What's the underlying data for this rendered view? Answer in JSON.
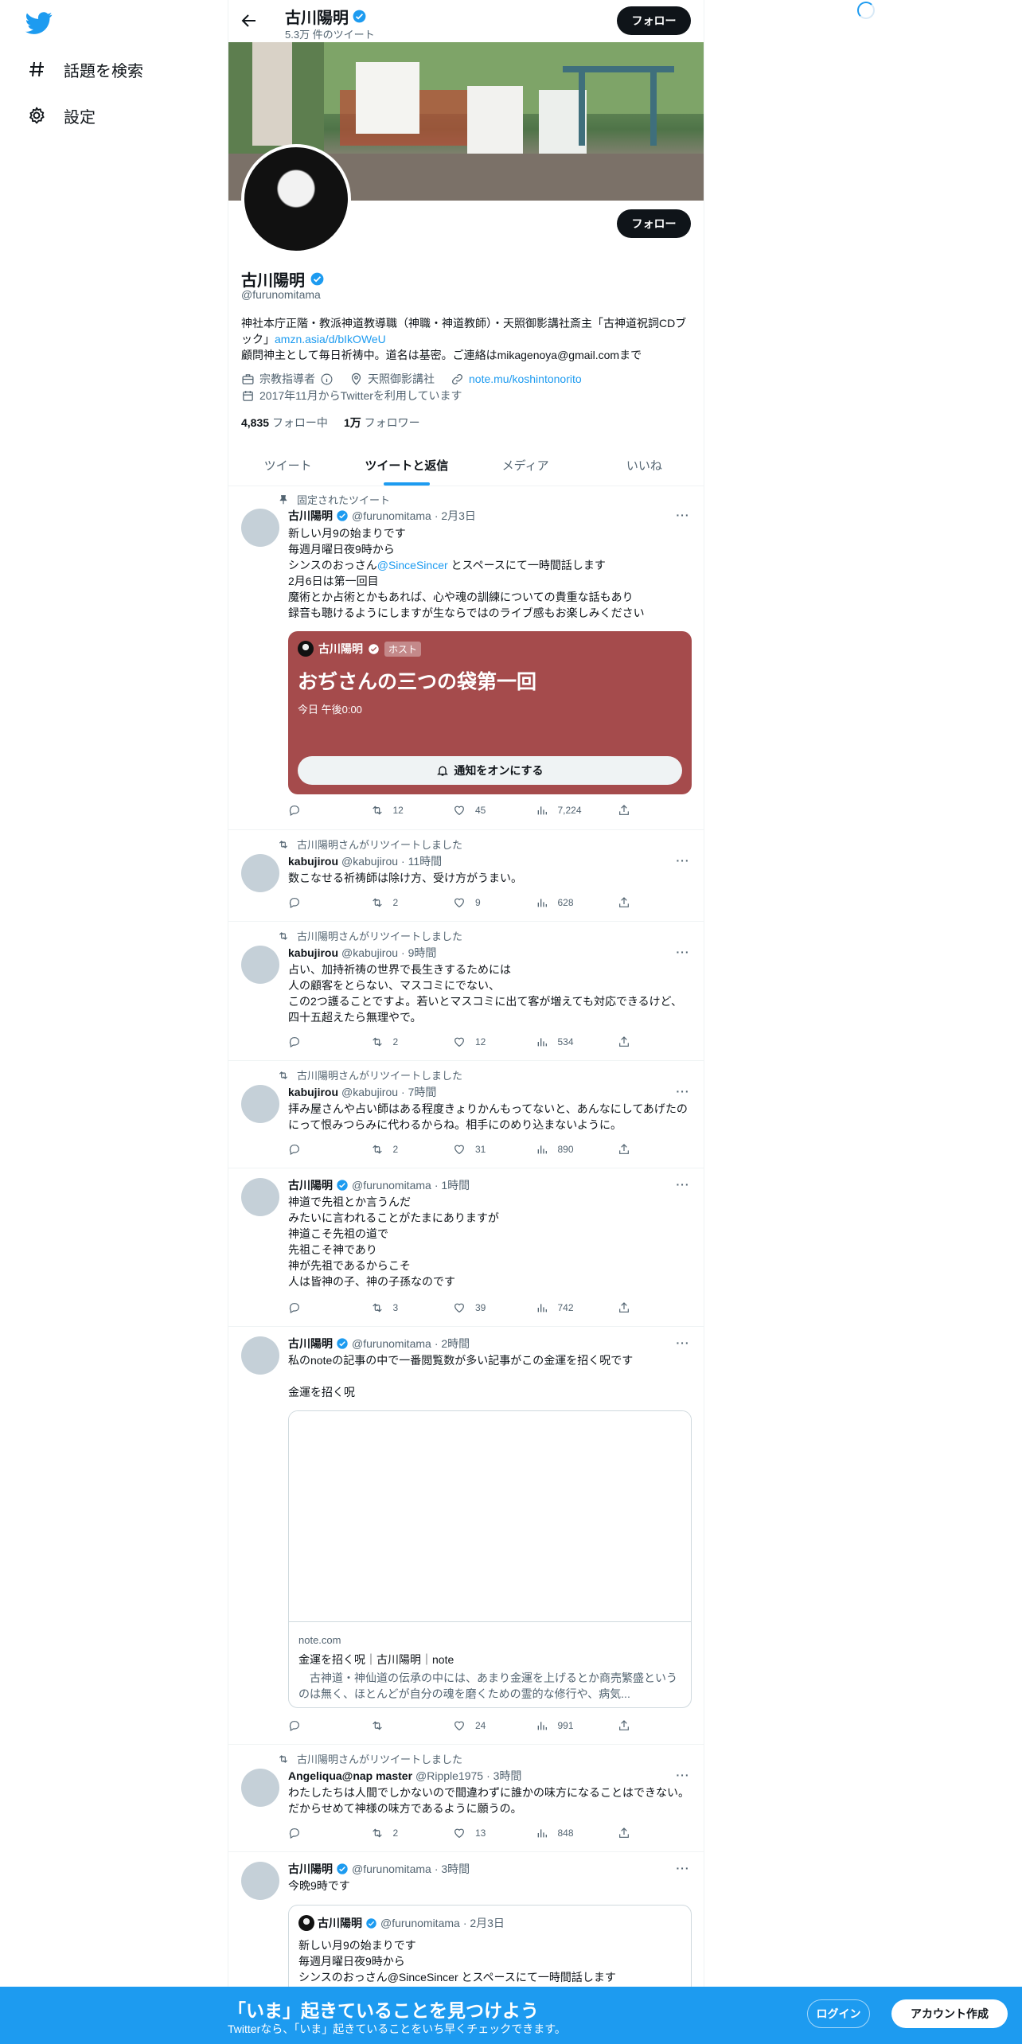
{
  "nav": {
    "explore_label": "話題を検索",
    "settings_label": "設定"
  },
  "header": {
    "name": "古川陽明",
    "tweet_count": "5.3万 件のツイート",
    "follow_label": "フォロー"
  },
  "profile": {
    "name": "古川陽明",
    "handle": "@furunomitama",
    "follow_label": "フォロー",
    "bio_line1": "神社本庁正階・教派神道教導職（神職・神道教師）・天照御影講社斎主「古神道祝詞CDブック」",
    "bio_link": "amzn.asia/d/bIkOWeU",
    "bio_line2": "顧問神主として毎日祈祷中。道名は基密。ご連絡はmikagenoya@gmail.comまで",
    "category": "宗教指導者",
    "location": "天照御影講社",
    "website": "note.mu/koshintonorito",
    "joined": "2017年11月からTwitterを利用しています",
    "following_count": "4,835",
    "following_label": "フォロー中",
    "followers_count": "1万",
    "followers_label": "フォロワー"
  },
  "tabs": [
    "ツイート",
    "ツイートと返信",
    "メディア",
    "いいね"
  ],
  "tweets": [
    {
      "context": "固定されたツイート",
      "name": "古川陽明",
      "handle": "@furunomitama",
      "time": "· 2月3日",
      "text_a": "新しい月9の始まりです\n毎週月曜日夜9時から\nシンスのおっさん",
      "text_mention": "@SinceSincer",
      "text_b": " とスペースにて一時間話します\n2月6日は第一回目\n魔術とか占術とかもあれば、心や魂の訓練についての貴重な話もあり\n録音も聴けるようにしますが生ならではのライブ感もお楽しみください",
      "reply": "",
      "retweet": "12",
      "like": "45",
      "views": "7,224"
    },
    {
      "context": "古川陽明さんがリツイートしました",
      "name": "kabujirou",
      "handle": "@kabujirou",
      "time": "· 11時間",
      "text": "数こなせる祈祷師は除け方、受け方がうまい。",
      "reply": "",
      "retweet": "2",
      "like": "9",
      "views": "628"
    },
    {
      "context": "古川陽明さんがリツイートしました",
      "name": "kabujirou",
      "handle": "@kabujirou",
      "time": "· 9時間",
      "text": "占い、加持祈祷の世界で長生きするためには\n人の顧客をとらない、マスコミにでない、\nこの2つ護ることですよ。若いとマスコミに出て客が増えても対応できるけど、四十五超えたら無理やで。",
      "reply": "",
      "retweet": "2",
      "like": "12",
      "views": "534"
    },
    {
      "context": "古川陽明さんがリツイートしました",
      "name": "kabujirou",
      "handle": "@kabujirou",
      "time": "· 7時間",
      "text": "拝み屋さんや占い師はある程度きょりかんもってないと、あんなにしてあげたのにって恨みつらみに代わるからね。相手にのめり込まないように。",
      "reply": "",
      "retweet": "2",
      "like": "31",
      "views": "890"
    },
    {
      "context": "",
      "name": "古川陽明",
      "handle": "@furunomitama",
      "time": "· 1時間",
      "text": "神道で先祖とか言うんだ\nみたいに言われることがたまにありますが\n神道こそ先祖の道で\n先祖こそ神であり\n神が先祖であるからこそ\n人は皆神の子、神の子孫なのです",
      "reply": "",
      "retweet": "3",
      "like": "39",
      "views": "742"
    },
    {
      "context": "",
      "name": "古川陽明",
      "handle": "@furunomitama",
      "time": "· 2時間",
      "text": "私のnoteの記事の中で一番閲覧数が多い記事がこの金運を招く呪です\n\n金運を招く呪",
      "reply": "",
      "retweet": "",
      "like": "24",
      "views": "991"
    },
    {
      "context": "古川陽明さんがリツイートしました",
      "name": "Angeliqua@nap master",
      "handle": "@Ripple1975",
      "time": "· 3時間",
      "text": "わたしたちは人間でしかないので間違わずに誰かの味方になることはできない。だからせめて神様の味方であるように願うの。",
      "reply": "",
      "retweet": "2",
      "like": "13",
      "views": "848"
    },
    {
      "context": "",
      "name": "古川陽明",
      "handle": "@furunomitama",
      "time": "· 3時間",
      "text": "今晩9時です"
    }
  ],
  "space": {
    "host_name": "古川陽明",
    "host_badge": "ホスト",
    "title": "おぢさんの三つの袋第一回",
    "time": "今日 午後0:00",
    "notify_label": "通知をオンにする",
    "bg_color": "#a54b4c"
  },
  "link_card": {
    "domain": "note.com",
    "title": "金運を招く呪｜古川陽明｜note",
    "desc": "　古神道・神仙道の伝承の中には、あまり金運を上げるとか商売繁盛というのは無く、ほとんどが自分の魂を磨くための霊的な修行や、病気..."
  },
  "quote": {
    "name": "古川陽明",
    "handle": "@furunomitama",
    "time": "· 2月3日",
    "text": "新しい月9の始まりです\n毎週月曜日夜9時から\nシンスのおっさん@SinceSincer とスペースにて一時間話します"
  },
  "bottom_bar": {
    "title": "「いま」起きていることを見つけよう",
    "subtitle": "Twitterなら、「いま」起きていることをいち早くチェックできます。",
    "login_label": "ログイン",
    "signup_label": "アカウント作成"
  },
  "colors": {
    "accent": "#1d9bf0",
    "text": "#0f1419",
    "muted": "#536471"
  }
}
